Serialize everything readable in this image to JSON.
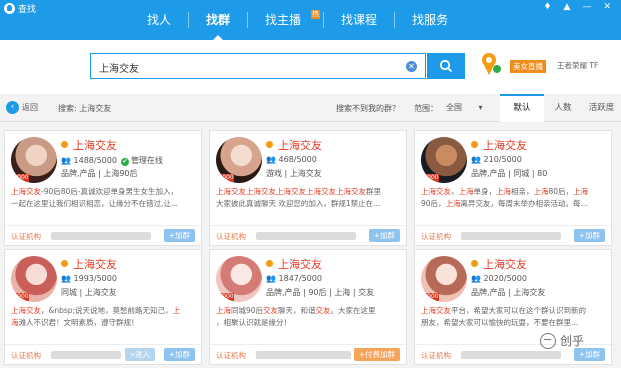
{
  "app": {
    "title": "查找",
    "controls": [
      "♦",
      "▲",
      "—",
      "✕"
    ]
  },
  "nav": {
    "items": [
      {
        "label": "找人",
        "active": false
      },
      {
        "label": "找群",
        "active": true
      },
      {
        "label": "找主播",
        "active": false,
        "badge": "热"
      },
      {
        "label": "找课程",
        "active": false
      },
      {
        "label": "找服务",
        "active": false
      }
    ]
  },
  "search": {
    "value": "上海交友",
    "clear_icon": "clear-icon",
    "button_icon": "search-icon"
  },
  "promo": {
    "tag": "美女直播",
    "text": "王者荣耀  TF"
  },
  "filter": {
    "back_label": "返回",
    "search_label": "搜索: 上海交友",
    "notfound": "搜索不到我的群？",
    "range_label": "范围：",
    "range_value": "全国",
    "sort_tabs": [
      "默认",
      "人数",
      "活跃度"
    ]
  },
  "cards": [
    {
      "name": "上海交友",
      "members": "1488/5000",
      "manager": "管理在线",
      "tags": "品牌,产品 | 上海90后",
      "desc1_html": "<span class=\"hl\">上海交友</span>-90后80后-真诚欢迎单身男生女生加入，",
      "desc2_html": "一起在这里让我们相识相恋，让缘分不在错过,让...",
      "cert": "认证机构",
      "join": "+加群",
      "avatar_colors": [
        "#3a1f1a",
        "#c99b86",
        "#f1d3c4"
      ]
    },
    {
      "name": "上海交友",
      "members": "468/5000",
      "tags": "游戏 | 上海交友",
      "desc1_html": "<span class=\"hl\">上海交友上海交友上海交友上海交友上海交友</span>群里",
      "desc2_html": "大家彼此真诚聊天 欢迎您的加入，群规1禁止在...",
      "cert": "认证机构",
      "join": "+加群",
      "avatar_colors": [
        "#2b1a14",
        "#d7a38c",
        "#f4ddd0"
      ]
    },
    {
      "name": "上海交友",
      "members": "210/5000",
      "tags": "品牌,产品 | 同城 | 80",
      "desc1_html": "<span class=\"hl\">上海交友</span>，<span class=\"hl\">上海</span>单身，<span class=\"hl\">上海</span>相亲，<span class=\"hl\">上海</span>80后，<span class=\"hl\">上海</span>",
      "desc2_html": "90后，<span class=\"hl\">上海</span>离异交友，每周末举办相亲活动。每...",
      "cert": "认证机构",
      "join": "+加群",
      "avatar_colors": [
        "#1a1a22",
        "#8a5a40",
        "#c98b5f"
      ]
    },
    {
      "name": "上海交友",
      "members": "1993/5000",
      "tags": "同城 | 上海交友",
      "desc1_html": "<span class=\"hl\">上海交友</span>，&amp;nbsp;说天说地，莫愁前路无知己，<span class=\"hl\">上</span>",
      "desc2_html": "<span class=\"hl\">海</span>滩人不识君！文明素质，遵守群规！",
      "cert": "认证机构",
      "enter": "»进入",
      "join": "+加群",
      "avatar_colors": [
        "#e8b4a8",
        "#c95f58",
        "#f6dcd4"
      ]
    },
    {
      "name": "上海交友",
      "members": "1847/5000",
      "tags": "品牌,产品 | 90后 | 上海 | 交友",
      "desc1_html": "<span class=\"hl\">上海</span>同城90后<span class=\"hl\">交友</span>聊天，和谐<span class=\"hl\">交友</span>。大家在这里",
      "desc2_html": "，相聚认识就是缘分！",
      "cert": "认证机构",
      "join": "+付费加群",
      "join_style": "orange",
      "avatar_colors": [
        "#f2c6c0",
        "#d37b74",
        "#faeae6"
      ]
    },
    {
      "name": "上海交友",
      "members": "2020/5000",
      "tags": "品牌,产品 | 上海交友",
      "desc1_html": "<span class=\"hl\">上海交友</span>平台，希望大家可以在这个群认识到新的",
      "desc2_html": "朋友，希望大家可以愉快的玩耍，不要在群里...",
      "cert": "认证机构",
      "join": "+加群",
      "avatar_colors": [
        "#efc2b5",
        "#b86a58",
        "#f8e2da"
      ]
    }
  ],
  "watermark": "创乎"
}
